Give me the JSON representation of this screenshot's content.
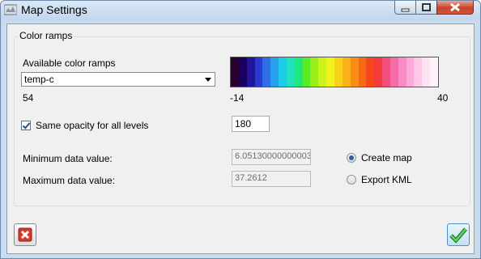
{
  "window": {
    "title": "Map Settings",
    "icon": "map-settings-app-icon",
    "controls": [
      "minimize-icon",
      "maximize-icon",
      "close-icon"
    ]
  },
  "group": {
    "title": "Color ramps"
  },
  "ramps": {
    "label": "Available color ramps",
    "selected": "temp-c",
    "count_label": "54",
    "min_label": "-14",
    "max_label": "40",
    "colors": [
      "#2a0030",
      "#1a0060",
      "#20169e",
      "#2a3ad0",
      "#2d6ee6",
      "#28a0ee",
      "#1ccbe8",
      "#1fe1c0",
      "#21e67e",
      "#58ea24",
      "#9aee18",
      "#cdf21a",
      "#f4f21c",
      "#f9d21a",
      "#fbaf18",
      "#f98d18",
      "#f76a1a",
      "#f5491c",
      "#f43a3a",
      "#f24e7a",
      "#f66ba8",
      "#f88bc4",
      "#fbaad8",
      "#fcc8e6",
      "#fde2f1",
      "#fff2fa"
    ]
  },
  "opacity": {
    "checkbox_label": "Same opacity for all levels",
    "checked": true,
    "value": "180"
  },
  "data_range": {
    "min_label": "Minimum data value:",
    "min_value": "6.05130000000003",
    "max_label": "Maximum data value:",
    "max_value": "37.2612"
  },
  "output": {
    "create_map_label": "Create map",
    "export_kml_label": "Export KML",
    "selected": "Create map"
  },
  "buttons": {
    "cancel_icon": "red-x-cancel-icon",
    "ok_icon": "green-check-ok-icon"
  },
  "colors": {
    "selection_accent": "#2d5c9a",
    "close_button": "#c9432c"
  }
}
